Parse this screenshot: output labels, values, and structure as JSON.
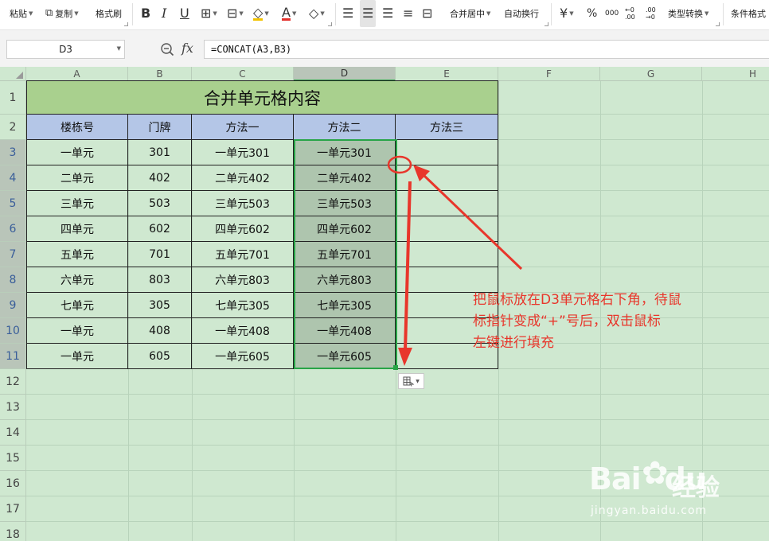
{
  "toolbar": {
    "paste": "粘贴",
    "copy": "复制",
    "format_painter": "格式刷",
    "bold": "B",
    "italic": "I",
    "underline": "U",
    "font_color_glyph": "A",
    "merge_center": "合并居中",
    "wrap_text": "自动换行",
    "currency": "¥",
    "percent": "%",
    "thousands": "000",
    "decimal_increase": "←0 .00",
    "decimal_decrease": ".00 →0",
    "type_convert": "类型转换",
    "conditional_format": "条件格式"
  },
  "formula_bar": {
    "name_box": "D3",
    "fx": "fx",
    "formula": "=CONCAT(A3,B3)"
  },
  "sheet": {
    "columns": [
      "A",
      "B",
      "C",
      "D",
      "E",
      "F",
      "G",
      "H"
    ],
    "selected_column": "D",
    "rows": [
      "1",
      "2",
      "3",
      "4",
      "5",
      "6",
      "7",
      "8",
      "9",
      "10",
      "11",
      "12",
      "13",
      "14",
      "15",
      "16",
      "17",
      "18"
    ],
    "title": "合并单元格内容",
    "headers": [
      "楼栋号",
      "门牌",
      "方法一",
      "方法二",
      "方法三"
    ],
    "data": [
      [
        "一单元",
        "301",
        "一单元301",
        "一单元301",
        ""
      ],
      [
        "二单元",
        "402",
        "二单元402",
        "二单元402",
        ""
      ],
      [
        "三单元",
        "503",
        "三单元503",
        "三单元503",
        ""
      ],
      [
        "四单元",
        "602",
        "四单元602",
        "四单元602",
        ""
      ],
      [
        "五单元",
        "701",
        "五单元701",
        "五单元701",
        ""
      ],
      [
        "六单元",
        "803",
        "六单元803",
        "六单元803",
        ""
      ],
      [
        "七单元",
        "305",
        "七单元305",
        "七单元305",
        ""
      ],
      [
        "一单元",
        "408",
        "一单元408",
        "一单元408",
        ""
      ],
      [
        "一单元",
        "605",
        "一单元605",
        "一单元605",
        ""
      ]
    ]
  },
  "annotation": {
    "line1": "把鼠标放在D3单元格右下角，待鼠",
    "line2": "标指针变成“+”号后，双击鼠标",
    "line3": "左键进行填充",
    "color": "#e8362b"
  },
  "watermark": {
    "brand": "Bai",
    "brand_suffix": "du",
    "cn": "经验",
    "url": "jingyan.baidu.com"
  },
  "colors": {
    "sheet_bg": "#cfe8d0",
    "title_fill": "#a9d08e",
    "header_fill": "#b4c6e7",
    "selection": "#28a447"
  }
}
